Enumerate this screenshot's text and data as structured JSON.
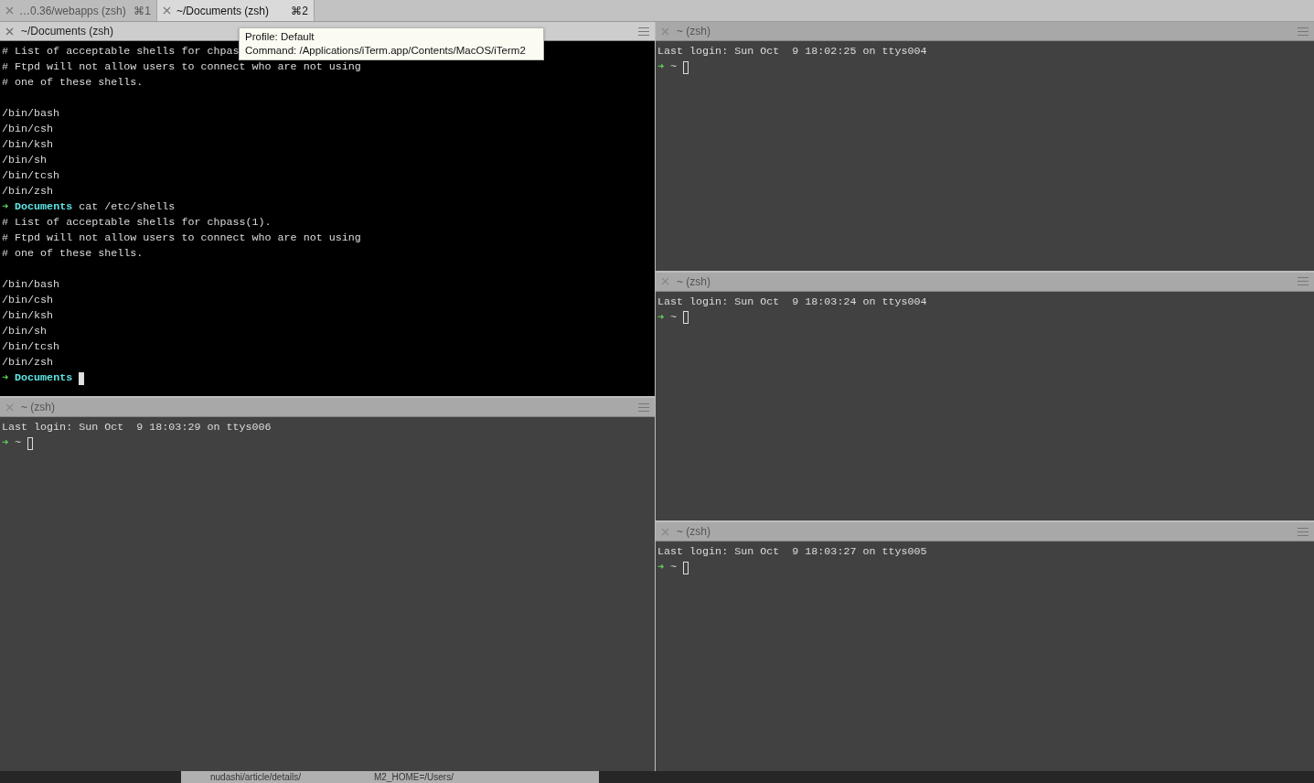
{
  "tabs": [
    {
      "label": "…0.36/webapps (zsh)",
      "shortcut": "⌘1",
      "selected": false
    },
    {
      "label": "~/Documents (zsh)",
      "shortcut": "⌘2",
      "selected": true
    }
  ],
  "columns": [
    {
      "panes": [
        {
          "title": "~/Documents (zsh)",
          "active": true,
          "lines": [
            {
              "kind": "text",
              "text": "# List of acceptable shells for chpas"
            },
            {
              "kind": "text",
              "text": "# Ftpd will not allow users to connect who are not using"
            },
            {
              "kind": "text",
              "text": "# one of these shells."
            },
            {
              "kind": "blank"
            },
            {
              "kind": "text",
              "text": "/bin/bash"
            },
            {
              "kind": "text",
              "text": "/bin/csh"
            },
            {
              "kind": "text",
              "text": "/bin/ksh"
            },
            {
              "kind": "text",
              "text": "/bin/sh"
            },
            {
              "kind": "text",
              "text": "/bin/tcsh"
            },
            {
              "kind": "text",
              "text": "/bin/zsh"
            },
            {
              "kind": "prompt",
              "arrow": "➜",
              "dir": "Documents",
              "command": "cat /etc/shells",
              "cursor": false
            },
            {
              "kind": "text",
              "text": "# List of acceptable shells for chpass(1)."
            },
            {
              "kind": "text",
              "text": "# Ftpd will not allow users to connect who are not using"
            },
            {
              "kind": "text",
              "text": "# one of these shells."
            },
            {
              "kind": "blank"
            },
            {
              "kind": "text",
              "text": "/bin/bash"
            },
            {
              "kind": "text",
              "text": "/bin/csh"
            },
            {
              "kind": "text",
              "text": "/bin/ksh"
            },
            {
              "kind": "text",
              "text": "/bin/sh"
            },
            {
              "kind": "text",
              "text": "/bin/tcsh"
            },
            {
              "kind": "text",
              "text": "/bin/zsh"
            },
            {
              "kind": "prompt",
              "arrow": "➜",
              "dir": "Documents",
              "cursor": true
            }
          ]
        },
        {
          "title": "~ (zsh)",
          "active": false,
          "lines": [
            {
              "kind": "text",
              "text": "Last login: Sun Oct  9 18:03:29 on ttys006"
            },
            {
              "kind": "prompt",
              "arrow": "➜",
              "home": "~",
              "cursor": true
            }
          ]
        }
      ]
    },
    {
      "panes": [
        {
          "title": "~ (zsh)",
          "active": false,
          "lines": [
            {
              "kind": "text",
              "text": "Last login: Sun Oct  9 18:02:25 on ttys004"
            },
            {
              "kind": "prompt",
              "arrow": "➜",
              "home": "~",
              "cursor": true
            }
          ]
        },
        {
          "title": "~ (zsh)",
          "active": false,
          "lines": [
            {
              "kind": "text",
              "text": "Last login: Sun Oct  9 18:03:24 on ttys004"
            },
            {
              "kind": "prompt",
              "arrow": "➜",
              "home": "~",
              "cursor": true
            }
          ]
        },
        {
          "title": "~ (zsh)",
          "active": false,
          "lines": [
            {
              "kind": "text",
              "text": "Last login: Sun Oct  9 18:03:27 on ttys005"
            },
            {
              "kind": "prompt",
              "arrow": "➜",
              "home": "~",
              "cursor": true
            }
          ]
        }
      ]
    }
  ],
  "tooltip": {
    "profile": "Profile: Default",
    "command": "Command: /Applications/iTerm.app/Contents/MacOS/iTerm2"
  },
  "background_window": {
    "texts": [
      "nudashi/article/details/",
      "M2_HOME=/Users/"
    ]
  }
}
